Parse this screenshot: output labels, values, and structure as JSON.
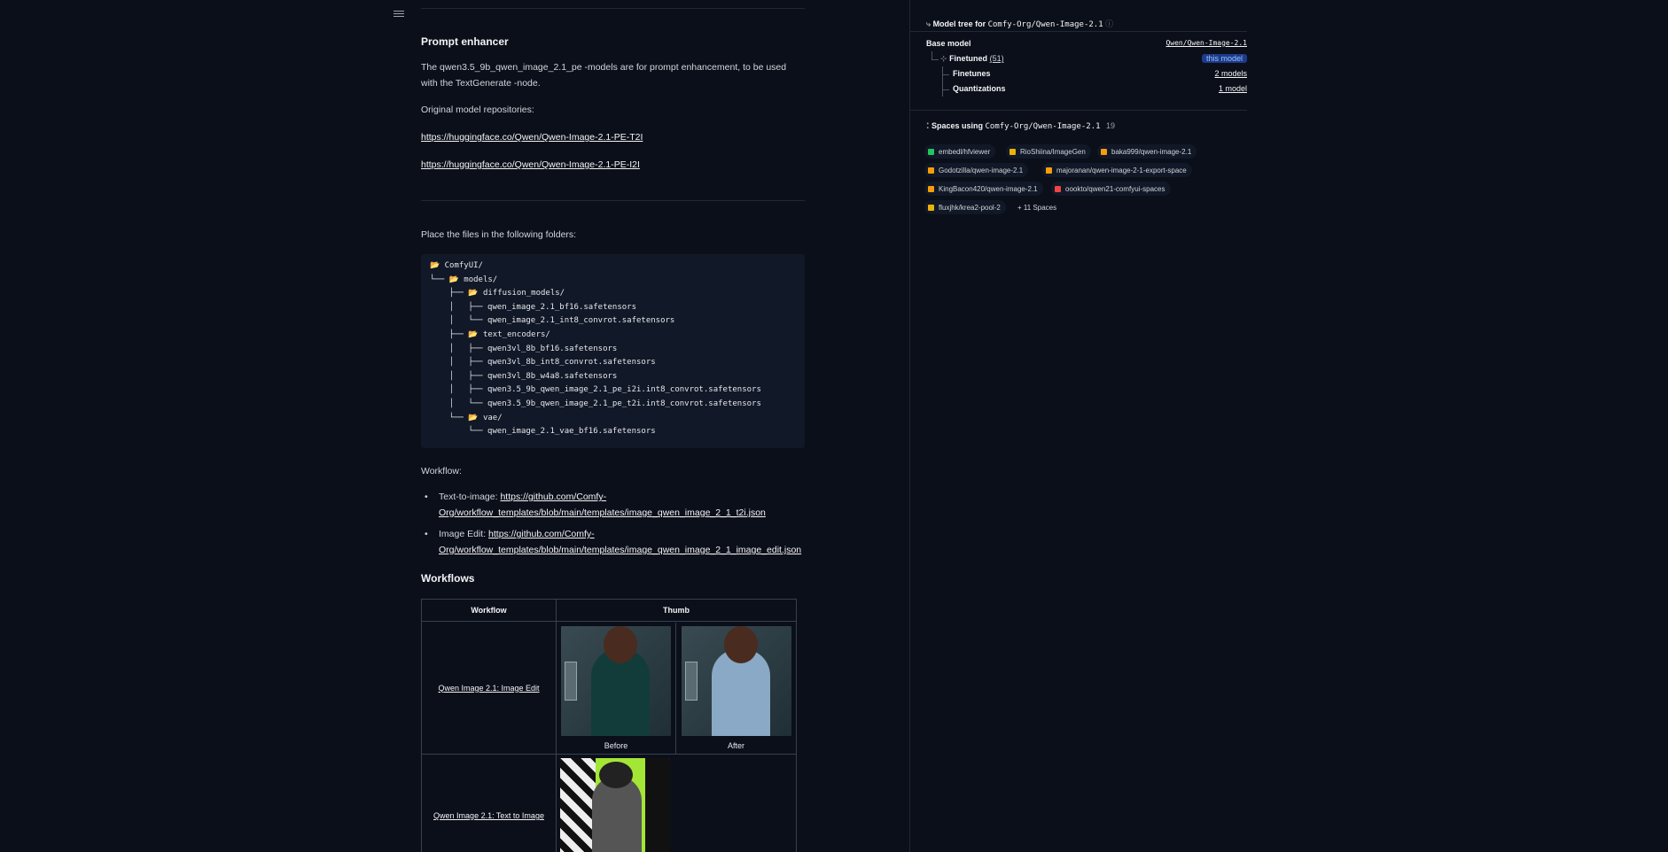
{
  "main": {
    "prompt_heading": "Prompt enhancer",
    "prompt_text": "The qwen3.5_9b_qwen_image_2.1_pe -models are for prompt enhancement, to be used with the TextGenerate -node.",
    "original_repos_label": "Original model repositories:",
    "repo_links": [
      "https://huggingface.co/Qwen/Qwen-Image-2.1-PE-T2I",
      "https://huggingface.co/Qwen/Qwen-Image-2.1-PE-I2I"
    ],
    "place_files_label": "Place the files in the following folders:",
    "code_lines": [
      "📂 ComfyUI/",
      "└── 📂 models/",
      "    ├── 📂 diffusion_models/",
      "    │   ├── qwen_image_2.1_bf16.safetensors",
      "    │   └── qwen_image_2.1_int8_convrot.safetensors",
      "    ├── 📂 text_encoders/",
      "    │   ├── qwen3vl_8b_bf16.safetensors",
      "    │   ├── qwen3vl_8b_int8_convrot.safetensors",
      "    │   ├── qwen3vl_8b_w4a8.safetensors",
      "    │   ├── qwen3.5_9b_qwen_image_2.1_pe_i2i.int8_convrot.safetensors",
      "    │   └── qwen3.5_9b_qwen_image_2.1_pe_t2i.int8_convrot.safetensors",
      "    └── 📂 vae/",
      "        └── qwen_image_2.1_vae_bf16.safetensors"
    ],
    "workflow_label": "Workflow:",
    "workflow_items": [
      {
        "prefix": "Text-to-image: ",
        "link_line1": "https://github.com/Comfy-",
        "link_line2": "Org/workflow_templates/blob/main/templates/image_qwen_image_2_1_t2i.json"
      },
      {
        "prefix": "Image Edit: ",
        "link_line1": "https://github.com/Comfy-",
        "link_line2": "Org/workflow_templates/blob/main/templates/image_qwen_image_2_1_image_edit.json"
      }
    ],
    "workflows_heading": "Workflows",
    "table": {
      "headers": [
        "Workflow",
        "Thumb"
      ],
      "rows": [
        {
          "name": "Qwen Image 2.1: Image Edit",
          "captions": [
            "Before",
            "After"
          ]
        },
        {
          "name": "Qwen Image 2.1: Text to Image",
          "captions": []
        }
      ]
    }
  },
  "sidebar": {
    "model_tree": {
      "title_prefix": "Model tree for",
      "repo": "Comfy-Org/Qwen-Image-2.1",
      "base_label": "Base model",
      "base_value": "Qwen/Qwen-Image-2.1",
      "finetuned_label": "Finetuned",
      "finetuned_count": "(51)",
      "finetuned_tag": "this model",
      "finetunes_label": "Finetunes",
      "finetunes_value": "2 models",
      "quant_label": "Quantizations",
      "quant_value": "1 model"
    },
    "spaces": {
      "title_prefix": "Spaces using",
      "repo": "Comfy-Org/Qwen-Image-2.1",
      "count": "19",
      "items": [
        {
          "label": "embedl/hfviewer",
          "color": "#22c55e"
        },
        {
          "label": "RioShiina/ImageGen",
          "color": "#eab308"
        },
        {
          "label": "baka999/qwen-image-2.1",
          "color": "#f59e0b"
        },
        {
          "label": "Godotzilla/qwen-image-2.1",
          "color": "#f59e0b"
        },
        {
          "label": "majoranan/qwen-image-2-1-export-space",
          "color": "#f59e0b"
        },
        {
          "label": "KingBacon420/qwen-image-2.1",
          "color": "#f59e0b"
        },
        {
          "label": "oookto/qwen21-comfyui-spaces",
          "color": "#ef4444"
        },
        {
          "label": "fluxjhk/krea2-pool-2",
          "color": "#eab308"
        }
      ],
      "more": "+ 11 Spaces"
    }
  }
}
